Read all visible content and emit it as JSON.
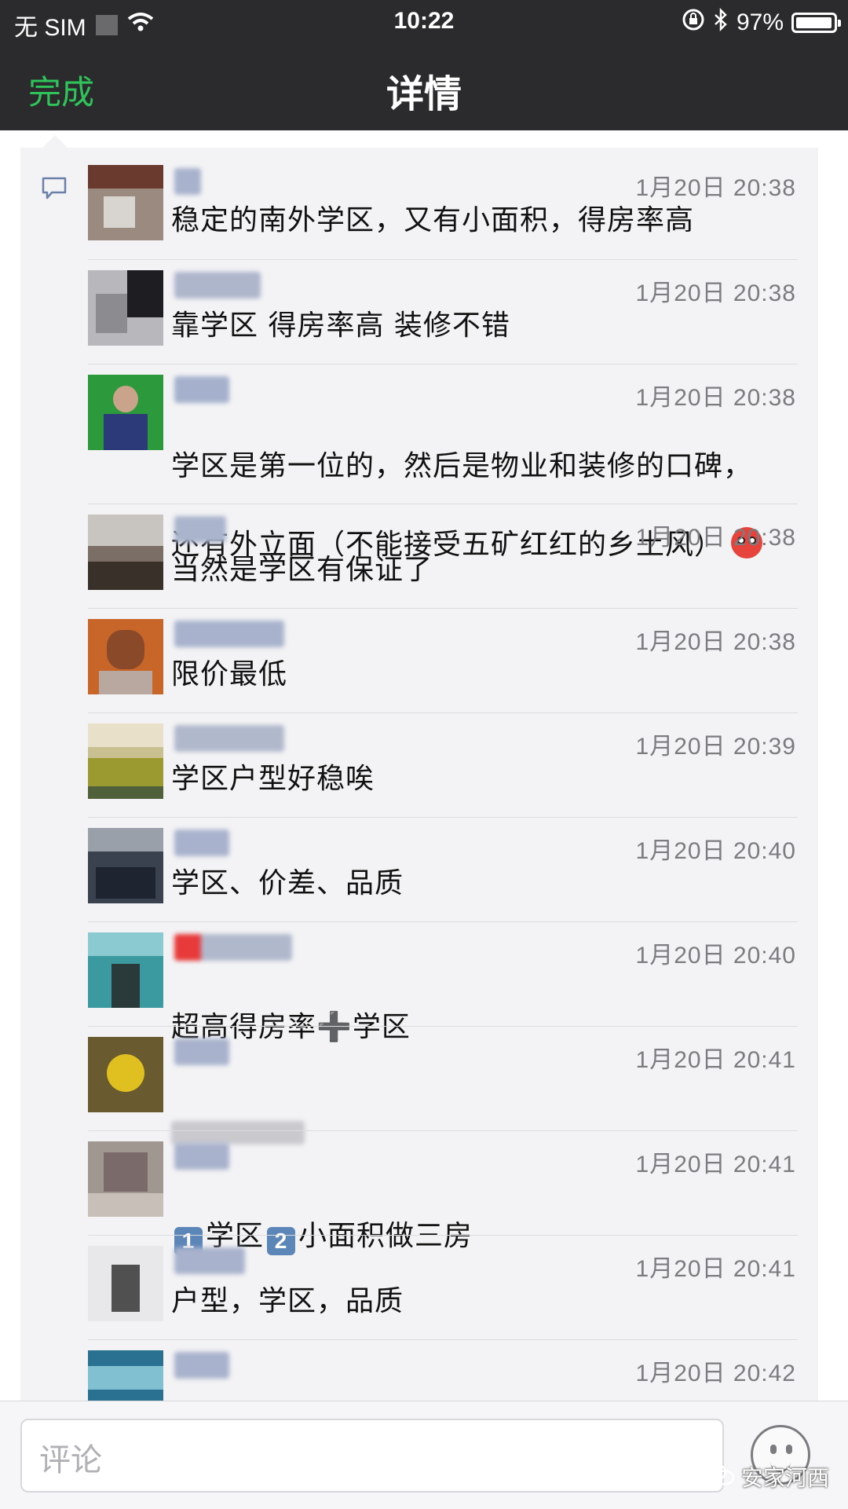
{
  "status_bar": {
    "carrier": "无 SIM",
    "time": "10:22",
    "battery": "97%",
    "battery_level": 0.97
  },
  "nav": {
    "done": "完成",
    "title": "详情"
  },
  "comments": [
    {
      "time": "1月20日 20:38",
      "text": "稳定的南外学区，又有小面积，得房率高"
    },
    {
      "time": "1月20日 20:38",
      "text": "靠学区   得房率高   装修不错"
    },
    {
      "time": "1月20日 20:38",
      "line1": "学区是第一位的，然后是物业和装修的口碑，",
      "line2": "还有外立面（不能接受五矿红红的乡土风）"
    },
    {
      "time": "1月20日 20:38",
      "text": "当然是学区有保证了"
    },
    {
      "time": "1月20日 20:38",
      "text": "限价最低"
    },
    {
      "time": "1月20日 20:39",
      "text": "学区户型好稳唉"
    },
    {
      "time": "1月20日 20:40",
      "text": "学区、价差、品质"
    },
    {
      "time": "1月20日 20:40",
      "before": "超高得房率",
      "plus": "➕",
      "after": "学区"
    },
    {
      "time": "1月20日 20:41"
    },
    {
      "time": "1月20日 20:41",
      "key1": "1",
      "part1": "学区",
      "key2": "2",
      "part2": "小面积做三房"
    },
    {
      "time": "1月20日 20:41",
      "text": "户型，学区，品质"
    },
    {
      "time": "1月20日 20:42"
    }
  ],
  "input": {
    "placeholder": "评论"
  },
  "watermark": "安家河西"
}
